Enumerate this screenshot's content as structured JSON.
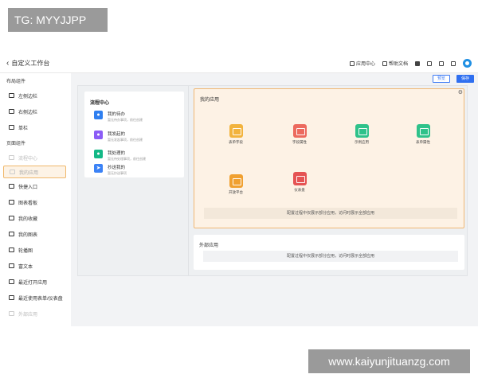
{
  "watermarks": {
    "top": "TG: MYYJJPP",
    "bottom": "www.kaiyunjituanzg.com"
  },
  "header": {
    "title": "自定义工作台",
    "tools": [
      {
        "label": "应用中心",
        "icon": "grid-icon"
      },
      {
        "label": "帮助文档",
        "icon": "doc-icon"
      }
    ]
  },
  "sidebar": {
    "layout_title": "布局组件",
    "layout_items": [
      {
        "label": "左侧边栏"
      },
      {
        "label": "右侧边栏"
      },
      {
        "label": "单栏"
      }
    ],
    "page_title": "页面组件",
    "page_items": [
      {
        "label": "流程中心",
        "state": "disabled"
      },
      {
        "label": "我的应用",
        "state": "selected"
      },
      {
        "label": "快捷入口",
        "state": "normal"
      },
      {
        "label": "图表看板",
        "state": "normal"
      },
      {
        "label": "我的收藏",
        "state": "normal"
      },
      {
        "label": "我的图表",
        "state": "normal"
      },
      {
        "label": "轮播图",
        "state": "normal"
      },
      {
        "label": "富文本",
        "state": "normal"
      },
      {
        "label": "最近打开应用",
        "state": "normal"
      },
      {
        "label": "最近使用表单/仪表盘",
        "state": "normal"
      },
      {
        "label": "外部应用",
        "state": "disabled"
      }
    ]
  },
  "actions": {
    "preview": "预览",
    "save": "保存"
  },
  "flow_center": {
    "title": "流程中心",
    "items": [
      {
        "title": "我的待办",
        "sub": "暂无待办事项，前往创建",
        "color": "#2f7ff0",
        "icon": "bell-icon"
      },
      {
        "title": "我发起的",
        "sub": "暂无发起事项，前往创建",
        "color": "#8b5cf6",
        "icon": "send-icon"
      },
      {
        "title": "我处理的",
        "sub": "暂无待处理事项，前往创建",
        "color": "#13b886",
        "icon": "check-icon"
      },
      {
        "title": "抄送我的",
        "sub": "暂无抄送事项",
        "color": "#3b82f6",
        "icon": "cc-icon"
      }
    ]
  },
  "my_apps": {
    "title": "我的应用",
    "apps": [
      {
        "label": "表单字段",
        "color": "#f2b33d"
      },
      {
        "label": "字段属性",
        "color": "#ec6a5e"
      },
      {
        "label": "示例应用",
        "color": "#2fc28a"
      },
      {
        "label": "表单属性",
        "color": "#2fc28a"
      },
      {
        "label": "开放平台",
        "color": "#f0a030"
      },
      {
        "label": "仪表盘",
        "color": "#e55353"
      }
    ],
    "note": "配置过程中仅展示部分应用，访问时展示全部应用"
  },
  "external_apps": {
    "title": "外部应用",
    "note": "配置过程中仅展示部分应用，访问时展示全部应用"
  },
  "colors": {
    "accent": "#2f6ff0",
    "selection": "#f0b774"
  }
}
